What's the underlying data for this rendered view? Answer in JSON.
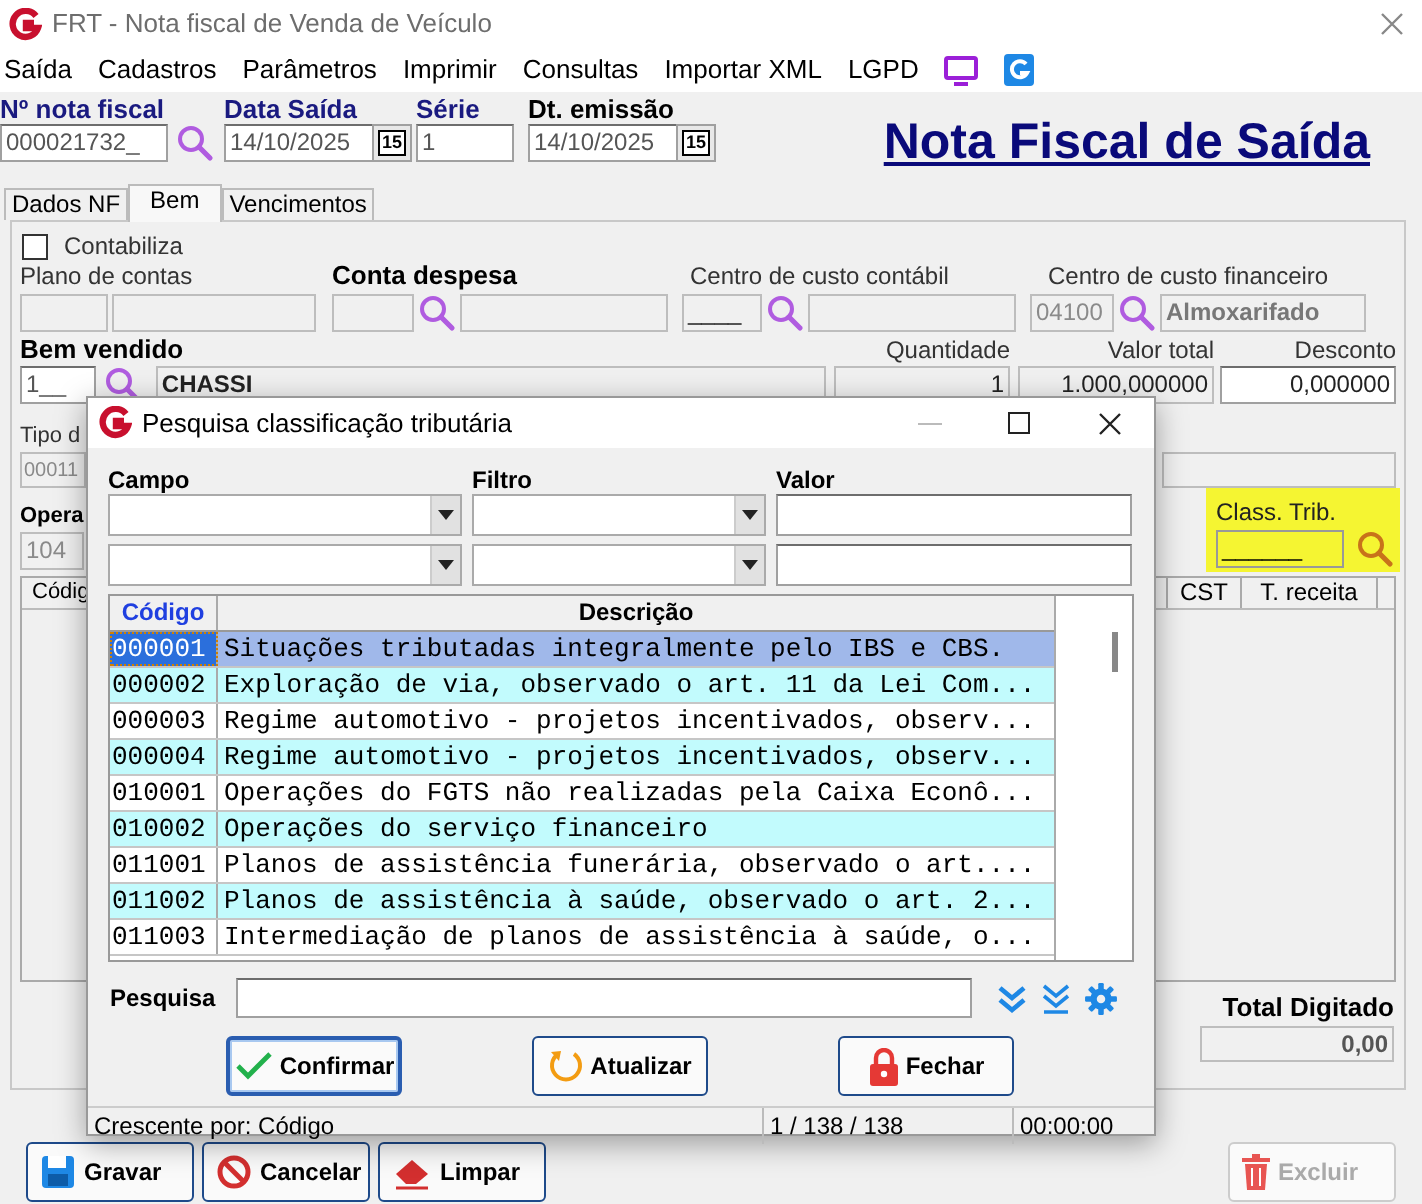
{
  "window": {
    "title": "FRT - Nota fiscal de Venda de Veículo"
  },
  "menu": [
    "Saída",
    "Cadastros",
    "Parâmetros",
    "Imprimir",
    "Consultas",
    "Importar XML",
    "LGPD"
  ],
  "header_fields": [
    {
      "label": "Nº nota fiscal",
      "value": "000021732_",
      "kind": "search",
      "emphasis": true
    },
    {
      "label": "Data Saída",
      "value": "14/10/2025",
      "kind": "date",
      "icon_text": "15",
      "emphasis": true
    },
    {
      "label": "Série",
      "value": "1",
      "kind": "plain",
      "emphasis": true
    },
    {
      "label": "Dt. emissão",
      "value": "14/10/2025",
      "kind": "date",
      "icon_text": "15",
      "emphasis": false
    }
  ],
  "page_title": "Nota Fiscal de Saída",
  "tabs": [
    {
      "label": "Dados NF",
      "selected": false
    },
    {
      "label": "Bem",
      "selected": true
    },
    {
      "label": "Vencimentos",
      "selected": false
    }
  ],
  "bem": {
    "contabiliza": {
      "label": "Contabiliza",
      "checked": false
    },
    "plano_de_contas": {
      "label": "Plano de contas"
    },
    "conta_despesa": {
      "label": "Conta despesa"
    },
    "centro_custo_contabil": {
      "label": "Centro de custo contábil",
      "code": "____"
    },
    "centro_custo_financeiro": {
      "label": "Centro de custo financeiro",
      "code": "04100",
      "name": "Almoxarifado"
    },
    "bem_vendido": {
      "label": "Bem vendido",
      "code": "1__",
      "name": "CHASSI"
    },
    "quantidade": {
      "label": "Quantidade",
      "value": "1"
    },
    "valor_total": {
      "label": "Valor total",
      "value": "1.000,000000"
    },
    "desconto": {
      "label": "Desconto",
      "value": "0,000000"
    },
    "tipo": {
      "label": "Tipo d",
      "code": "00011"
    },
    "operacao": {
      "label": "Opera",
      "code": "104"
    },
    "class_trib": {
      "label": "Class. Trib.",
      "value": "______"
    },
    "table_columns": [
      "Códig",
      "CST",
      "T. receita"
    ],
    "total_digitado": {
      "label": "Total Digitado",
      "value": "0,00"
    }
  },
  "actions": [
    {
      "label": "Gravar",
      "kind": "save",
      "disabled": false
    },
    {
      "label": "Cancelar",
      "kind": "cancel",
      "disabled": false
    },
    {
      "label": "Limpar",
      "kind": "clear",
      "disabled": false
    },
    {
      "label": "Excluir",
      "kind": "delete",
      "disabled": true
    }
  ],
  "dialog": {
    "title": "Pesquisa classificação tributária",
    "filter_labels": [
      "Campo",
      "Filtro",
      "Valor"
    ],
    "columns": [
      "Código",
      "Descrição"
    ],
    "rows": [
      {
        "code": "000001",
        "description": "Situações tributadas integralmente pelo IBS e CBS.",
        "selected": true
      },
      {
        "code": "000002",
        "description": "Exploração de via, observado o art. 11 da Lei Com...",
        "selected": false
      },
      {
        "code": "000003",
        "description": "Regime automotivo - projetos incentivados, observ...",
        "selected": false
      },
      {
        "code": "000004",
        "description": "Regime automotivo - projetos incentivados, observ...",
        "selected": false
      },
      {
        "code": "010001",
        "description": "Operações do FGTS não realizadas pela Caixa Econô...",
        "selected": false
      },
      {
        "code": "010002",
        "description": "Operações do serviço financeiro",
        "selected": false
      },
      {
        "code": "011001",
        "description": "Planos de assistência funerária, observado o art....",
        "selected": false
      },
      {
        "code": "011002",
        "description": "Planos de assistência à saúde, observado o art. 2...",
        "selected": false
      },
      {
        "code": "011003",
        "description": "Intermediação de planos de assistência à saúde, o...",
        "selected": false
      }
    ],
    "search_label": "Pesquisa",
    "buttons": [
      {
        "label": "Confirmar",
        "kind": "confirm",
        "default": true
      },
      {
        "label": "Atualizar",
        "kind": "refresh",
        "default": false
      },
      {
        "label": "Fechar",
        "kind": "close",
        "default": false
      }
    ],
    "status": [
      "Crescente por: Código",
      "1 / 138 / 138",
      "00:00:00"
    ]
  }
}
